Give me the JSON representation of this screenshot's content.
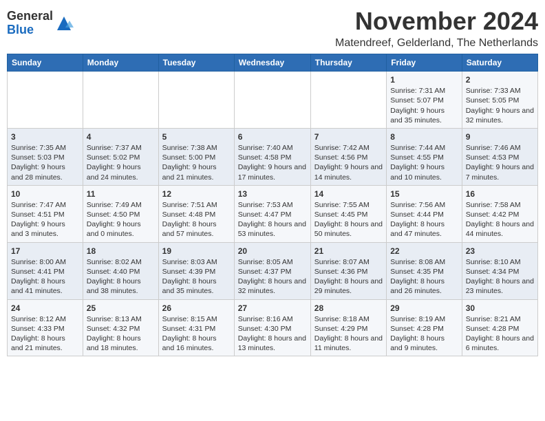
{
  "logo": {
    "line1": "General",
    "line2": "Blue"
  },
  "title": "November 2024",
  "location": "Matendreef, Gelderland, The Netherlands",
  "days_of_week": [
    "Sunday",
    "Monday",
    "Tuesday",
    "Wednesday",
    "Thursday",
    "Friday",
    "Saturday"
  ],
  "weeks": [
    [
      {
        "day": "",
        "data": ""
      },
      {
        "day": "",
        "data": ""
      },
      {
        "day": "",
        "data": ""
      },
      {
        "day": "",
        "data": ""
      },
      {
        "day": "",
        "data": ""
      },
      {
        "day": "1",
        "data": "Sunrise: 7:31 AM\nSunset: 5:07 PM\nDaylight: 9 hours and 35 minutes."
      },
      {
        "day": "2",
        "data": "Sunrise: 7:33 AM\nSunset: 5:05 PM\nDaylight: 9 hours and 32 minutes."
      }
    ],
    [
      {
        "day": "3",
        "data": "Sunrise: 7:35 AM\nSunset: 5:03 PM\nDaylight: 9 hours and 28 minutes."
      },
      {
        "day": "4",
        "data": "Sunrise: 7:37 AM\nSunset: 5:02 PM\nDaylight: 9 hours and 24 minutes."
      },
      {
        "day": "5",
        "data": "Sunrise: 7:38 AM\nSunset: 5:00 PM\nDaylight: 9 hours and 21 minutes."
      },
      {
        "day": "6",
        "data": "Sunrise: 7:40 AM\nSunset: 4:58 PM\nDaylight: 9 hours and 17 minutes."
      },
      {
        "day": "7",
        "data": "Sunrise: 7:42 AM\nSunset: 4:56 PM\nDaylight: 9 hours and 14 minutes."
      },
      {
        "day": "8",
        "data": "Sunrise: 7:44 AM\nSunset: 4:55 PM\nDaylight: 9 hours and 10 minutes."
      },
      {
        "day": "9",
        "data": "Sunrise: 7:46 AM\nSunset: 4:53 PM\nDaylight: 9 hours and 7 minutes."
      }
    ],
    [
      {
        "day": "10",
        "data": "Sunrise: 7:47 AM\nSunset: 4:51 PM\nDaylight: 9 hours and 3 minutes."
      },
      {
        "day": "11",
        "data": "Sunrise: 7:49 AM\nSunset: 4:50 PM\nDaylight: 9 hours and 0 minutes."
      },
      {
        "day": "12",
        "data": "Sunrise: 7:51 AM\nSunset: 4:48 PM\nDaylight: 8 hours and 57 minutes."
      },
      {
        "day": "13",
        "data": "Sunrise: 7:53 AM\nSunset: 4:47 PM\nDaylight: 8 hours and 53 minutes."
      },
      {
        "day": "14",
        "data": "Sunrise: 7:55 AM\nSunset: 4:45 PM\nDaylight: 8 hours and 50 minutes."
      },
      {
        "day": "15",
        "data": "Sunrise: 7:56 AM\nSunset: 4:44 PM\nDaylight: 8 hours and 47 minutes."
      },
      {
        "day": "16",
        "data": "Sunrise: 7:58 AM\nSunset: 4:42 PM\nDaylight: 8 hours and 44 minutes."
      }
    ],
    [
      {
        "day": "17",
        "data": "Sunrise: 8:00 AM\nSunset: 4:41 PM\nDaylight: 8 hours and 41 minutes."
      },
      {
        "day": "18",
        "data": "Sunrise: 8:02 AM\nSunset: 4:40 PM\nDaylight: 8 hours and 38 minutes."
      },
      {
        "day": "19",
        "data": "Sunrise: 8:03 AM\nSunset: 4:39 PM\nDaylight: 8 hours and 35 minutes."
      },
      {
        "day": "20",
        "data": "Sunrise: 8:05 AM\nSunset: 4:37 PM\nDaylight: 8 hours and 32 minutes."
      },
      {
        "day": "21",
        "data": "Sunrise: 8:07 AM\nSunset: 4:36 PM\nDaylight: 8 hours and 29 minutes."
      },
      {
        "day": "22",
        "data": "Sunrise: 8:08 AM\nSunset: 4:35 PM\nDaylight: 8 hours and 26 minutes."
      },
      {
        "day": "23",
        "data": "Sunrise: 8:10 AM\nSunset: 4:34 PM\nDaylight: 8 hours and 23 minutes."
      }
    ],
    [
      {
        "day": "24",
        "data": "Sunrise: 8:12 AM\nSunset: 4:33 PM\nDaylight: 8 hours and 21 minutes."
      },
      {
        "day": "25",
        "data": "Sunrise: 8:13 AM\nSunset: 4:32 PM\nDaylight: 8 hours and 18 minutes."
      },
      {
        "day": "26",
        "data": "Sunrise: 8:15 AM\nSunset: 4:31 PM\nDaylight: 8 hours and 16 minutes."
      },
      {
        "day": "27",
        "data": "Sunrise: 8:16 AM\nSunset: 4:30 PM\nDaylight: 8 hours and 13 minutes."
      },
      {
        "day": "28",
        "data": "Sunrise: 8:18 AM\nSunset: 4:29 PM\nDaylight: 8 hours and 11 minutes."
      },
      {
        "day": "29",
        "data": "Sunrise: 8:19 AM\nSunset: 4:28 PM\nDaylight: 8 hours and 9 minutes."
      },
      {
        "day": "30",
        "data": "Sunrise: 8:21 AM\nSunset: 4:28 PM\nDaylight: 8 hours and 6 minutes."
      }
    ]
  ]
}
